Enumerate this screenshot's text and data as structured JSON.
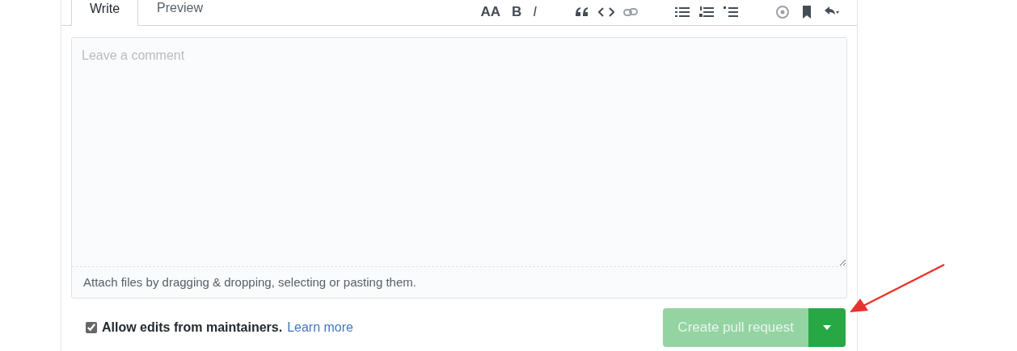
{
  "tabs": [
    {
      "label": "Write",
      "selected": true
    },
    {
      "label": "Preview",
      "selected": false
    }
  ],
  "toolbar": {
    "text_buttons": [
      {
        "label": "AA",
        "kind": "header"
      },
      {
        "label": "B",
        "kind": "bold"
      },
      {
        "label": "I",
        "kind": "italic"
      }
    ]
  },
  "comment": {
    "placeholder": "Leave a comment",
    "attach_hint": "Attach files by dragging & dropping, selecting or pasting them."
  },
  "allow_edits": {
    "label": "Allow edits from maintainers.",
    "checked": true,
    "link": "Learn more"
  },
  "submit": {
    "label": "Create pull request",
    "disabled": true
  }
}
